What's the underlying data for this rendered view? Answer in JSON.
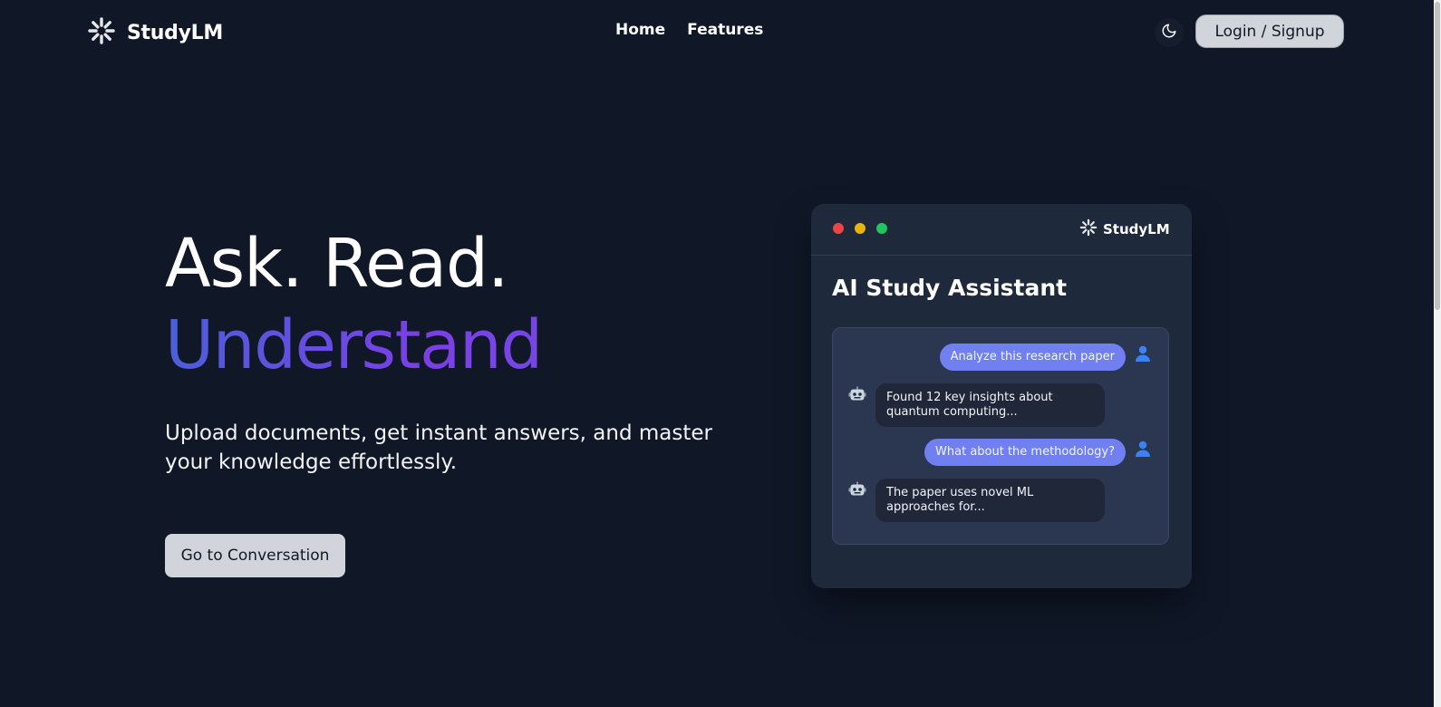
{
  "header": {
    "brand": "StudyLM",
    "nav": [
      "Home",
      "Features"
    ],
    "login_label": "Login / Signup"
  },
  "hero": {
    "line1": "Ask. Read.",
    "line2": "Understand",
    "subtitle": "Upload documents, get instant answers, and master your knowledge effortlessly.",
    "cta_label": "Go to Conversation"
  },
  "mockup": {
    "brand": "StudyLM",
    "title": "AI Study Assistant",
    "messages": [
      {
        "role": "user",
        "text": "Analyze this research paper"
      },
      {
        "role": "bot",
        "text": "Found 12 key insights about quantum computing..."
      },
      {
        "role": "user",
        "text": "What about the methodology?"
      },
      {
        "role": "bot",
        "text": "The paper uses novel ML approaches for..."
      }
    ]
  },
  "icons": {
    "brand": "spinner-logo-icon",
    "theme": "moon-icon",
    "user": "user-avatar-icon",
    "bot": "robot-icon"
  },
  "colors": {
    "background": "#101828",
    "gradient_start": "#4b5fd9",
    "gradient_end": "#7b3fe4",
    "user_bubble": "#7180f0",
    "bot_bubble": "#1f2738"
  }
}
